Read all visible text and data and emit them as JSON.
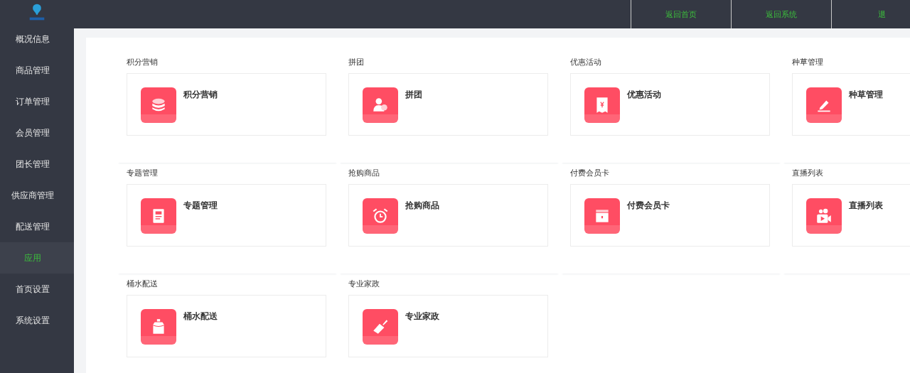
{
  "header": {
    "links": [
      {
        "label": "返回首页"
      },
      {
        "label": "返回系统"
      },
      {
        "label": "退"
      }
    ]
  },
  "sidebar": {
    "items": [
      {
        "label": "概况信息",
        "selected": false
      },
      {
        "label": "商品管理",
        "selected": false
      },
      {
        "label": "订单管理",
        "selected": false
      },
      {
        "label": "会员管理",
        "selected": false
      },
      {
        "label": "团长管理",
        "selected": false
      },
      {
        "label": "供应商管理",
        "selected": false
      },
      {
        "label": "配送管理",
        "selected": false
      },
      {
        "label": "应用",
        "selected": true
      },
      {
        "label": "首页设置",
        "selected": false
      },
      {
        "label": "系统设置",
        "selected": false
      }
    ]
  },
  "apps": [
    {
      "section": "积分营销",
      "title": "积分营销",
      "kind": "coins"
    },
    {
      "section": "拼团",
      "title": "拼团",
      "kind": "group"
    },
    {
      "section": "优惠活动",
      "title": "优惠活动",
      "kind": "coupon"
    },
    {
      "section": "种草管理",
      "title": "种草管理",
      "kind": "pen"
    },
    {
      "section": "专题管理",
      "title": "专题管理",
      "kind": "document"
    },
    {
      "section": "抢购商品",
      "title": "抢购商品",
      "kind": "alarm"
    },
    {
      "section": "付费会员卡",
      "title": "付费会员卡",
      "kind": "card"
    },
    {
      "section": "直播列表",
      "title": "直播列表",
      "kind": "video"
    },
    {
      "section": "桶水配送",
      "title": "桶水配送",
      "kind": "bottle"
    },
    {
      "section": "专业家政",
      "title": "专业家政",
      "kind": "broom"
    }
  ]
}
